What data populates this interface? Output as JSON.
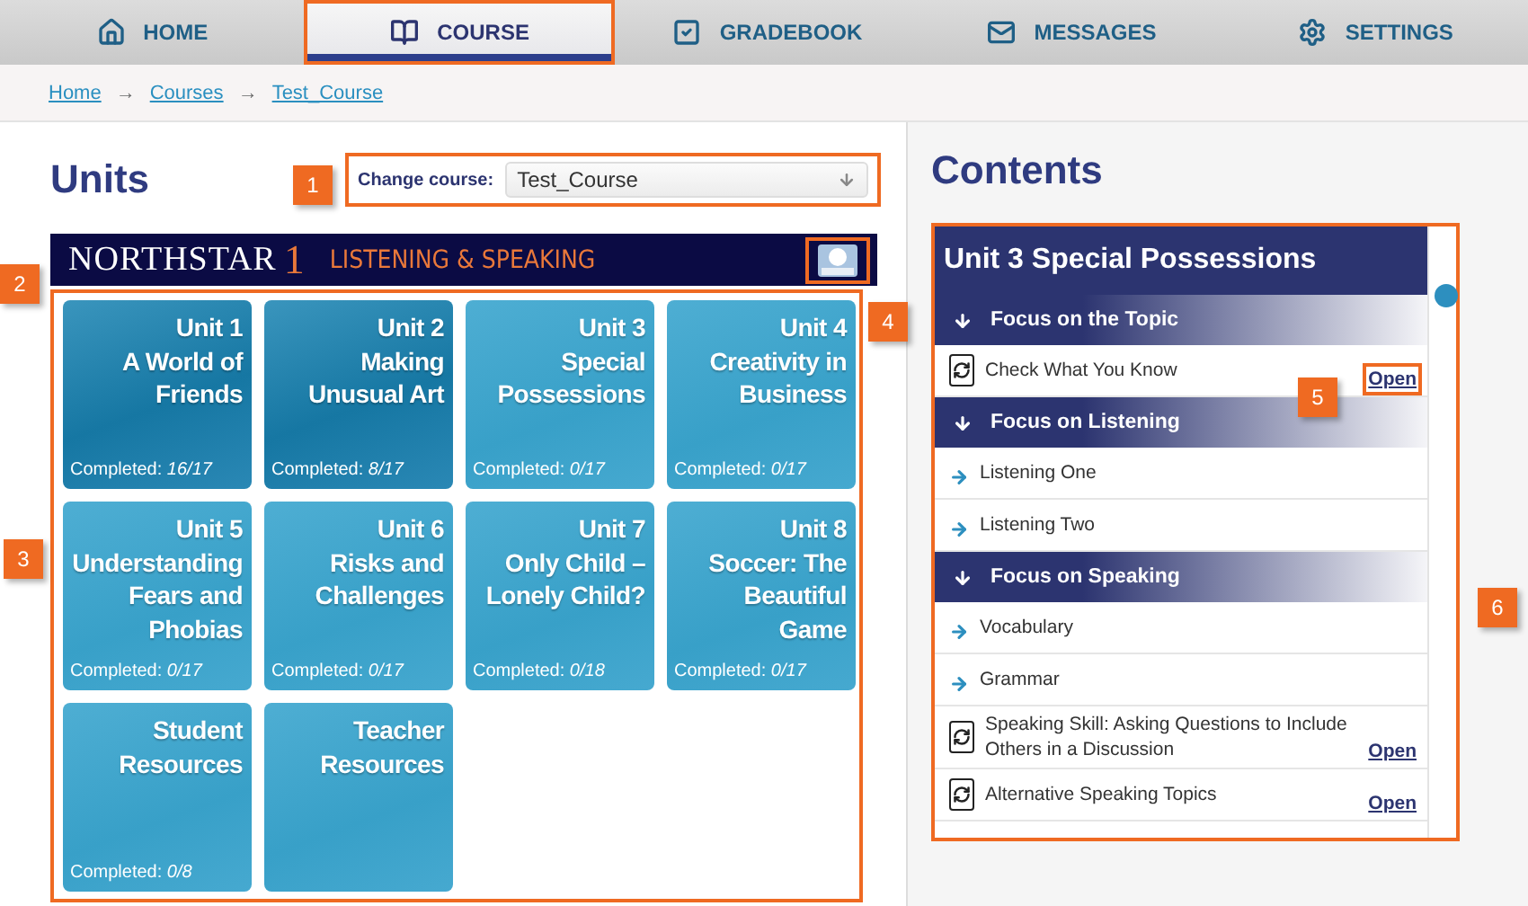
{
  "nav": {
    "tabs": [
      {
        "label": "HOME",
        "kind": "home",
        "selected": false
      },
      {
        "label": "COURSE",
        "kind": "course",
        "selected": true
      },
      {
        "label": "GRADEBOOK",
        "kind": "gradebook",
        "selected": false
      },
      {
        "label": "MESSAGES",
        "kind": "messages",
        "selected": false
      },
      {
        "label": "SETTINGS",
        "kind": "settings",
        "selected": false
      }
    ]
  },
  "breadcrumb": {
    "separator": "→",
    "items": [
      "Home",
      "Courses",
      "Test_Course"
    ]
  },
  "units_panel": {
    "title": "Units",
    "change_course": {
      "label": "Change course:",
      "value": "Test_Course"
    },
    "banner": {
      "brand": "NORTHSTAR",
      "level": "1",
      "subtitle": "LISTENING & SPEAKING"
    },
    "tiles": [
      {
        "unit": "Unit 1",
        "name": "A World of Friends",
        "completed_label": "Completed:",
        "completed": "16/17",
        "started": true
      },
      {
        "unit": "Unit 2",
        "name": "Making Unusual Art",
        "completed_label": "Completed:",
        "completed": "8/17",
        "started": true
      },
      {
        "unit": "Unit 3",
        "name": "Special Possessions",
        "completed_label": "Completed:",
        "completed": "0/17",
        "started": false
      },
      {
        "unit": "Unit 4",
        "name": "Creativity in Business",
        "completed_label": "Completed:",
        "completed": "0/17",
        "started": false
      },
      {
        "unit": "Unit 5",
        "name": "Understanding Fears and Phobias",
        "completed_label": "Completed:",
        "completed": "0/17",
        "started": false
      },
      {
        "unit": "Unit 6",
        "name": "Risks and Challenges",
        "completed_label": "Completed:",
        "completed": "0/17",
        "started": false
      },
      {
        "unit": "Unit 7",
        "name": "Only Child – Lonely Child?",
        "completed_label": "Completed:",
        "completed": "0/18",
        "started": false
      },
      {
        "unit": "Unit 8",
        "name": "Soccer: The Beautiful Game",
        "completed_label": "Completed:",
        "completed": "0/17",
        "started": false
      },
      {
        "name": "Student Resources",
        "completed_label": "Completed:",
        "completed": "0/8",
        "started": false
      },
      {
        "name": "Teacher Resources",
        "started": false
      }
    ]
  },
  "contents_panel": {
    "title": "Contents",
    "unit_title": "Unit 3 Special Possessions",
    "sections": [
      {
        "heading": "Focus on the Topic",
        "items": [
          {
            "kind": "activity",
            "label": "Check What You Know",
            "action": "Open"
          }
        ]
      },
      {
        "heading": "Focus on Listening",
        "items": [
          {
            "kind": "link",
            "label": "Listening One"
          },
          {
            "kind": "link",
            "label": "Listening Two"
          }
        ]
      },
      {
        "heading": "Focus on Speaking",
        "items": [
          {
            "kind": "link",
            "label": "Vocabulary"
          },
          {
            "kind": "link",
            "label": "Grammar"
          },
          {
            "kind": "activity",
            "label": "Speaking Skill: Asking Questions to Include Others in a Discussion",
            "action": "Open"
          },
          {
            "kind": "activity",
            "label": "Alternative Speaking Topics",
            "action": "Open"
          }
        ]
      }
    ]
  },
  "callouts": [
    "1",
    "2",
    "3",
    "4",
    "5",
    "6"
  ]
}
